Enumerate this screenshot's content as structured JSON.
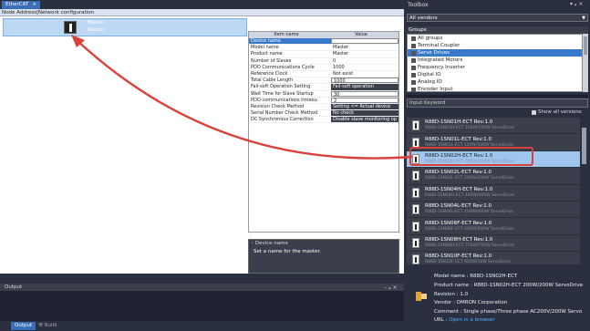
{
  "ethercat_tab": {
    "label": "EtherCAT",
    "close": "×"
  },
  "node_header": "Node Address|Network configuration",
  "master": {
    "line1": "Master",
    "line2": "Master"
  },
  "properties": {
    "col_item": "Item name",
    "col_value": "Value",
    "rows": [
      {
        "k": "Device name",
        "v": "Master",
        "style": "sel",
        "vstyle": "box"
      },
      {
        "k": "Model name",
        "v": "Master"
      },
      {
        "k": "Product name",
        "v": "Master"
      },
      {
        "k": "Number of Slaves",
        "v": "0"
      },
      {
        "k": "PDO Communications Cycle",
        "v": "1000"
      },
      {
        "k": "Reference Clock",
        "v": "Not exist"
      },
      {
        "k": "Total Cable Length",
        "v": "1000",
        "vstyle": "box"
      },
      {
        "k": "Fail-soft Operation Setting",
        "v": "Fail-soft operation",
        "vstyle": "dark"
      },
      {
        "k": "Wait Time for Slave Startup",
        "v": "30",
        "vstyle": "box"
      },
      {
        "k": "PDO communications timeou",
        "v": "2",
        "vstyle": "box"
      },
      {
        "k": "Revision Check Method",
        "v": "Setting <= Actual device",
        "vstyle": "dark"
      },
      {
        "k": "Serial Number Check Method",
        "v": "No check",
        "vstyle": "dark"
      },
      {
        "k": "DC Synchronous Correction",
        "v": "Disable slave monitoring op",
        "vstyle": "dark"
      }
    ]
  },
  "description": {
    "title": "Device name",
    "text": "Set a name for the master."
  },
  "output": {
    "title": "Output",
    "tab_output": "Output",
    "tab_build": "Build"
  },
  "toolbox": {
    "title": "Toolbox",
    "vendor": "All vendors",
    "groups_label": "Groups",
    "groups": [
      "All groups",
      "Terminal Coupler",
      "Servo Drives",
      "Integrated Motors",
      "Frequency Inverter",
      "Digital IO",
      "Analog IO",
      "Encoder Input"
    ],
    "selected_group": 2,
    "keyword_placeholder": "Input Keyword",
    "show_all_versions": "Show all versions",
    "items": [
      {
        "name": "R88D-1SN01H-ECT Rev:1.0",
        "desc": "R88D-1SN01H-ECT 100W/100W ServoDrive"
      },
      {
        "name": "R88D-1SN01L-ECT Rev:1.0",
        "desc": "R88D-1SN01L-ECT 100W/100W ServoDrive"
      },
      {
        "name": "R88D-1SN02H-ECT Rev:1.0",
        "desc": "R88D-1SN02H-ECT 200W/200W ServoDrive"
      },
      {
        "name": "R88D-1SN02L-ECT Rev:1.0",
        "desc": "R88D-1SN02L-ECT 200W/200W ServoDrive"
      },
      {
        "name": "R88D-1SN04H-ECT Rev:1.0",
        "desc": "R88D-1SN04H-ECT 400W/400W ServoDrive"
      },
      {
        "name": "R88D-1SN04L-ECT Rev:1.0",
        "desc": "R88D-1SN04L-ECT 400W/400W ServoDrive"
      },
      {
        "name": "R88D-1SN06F-ECT Rev:1.0",
        "desc": "R88D-1SN06F-ECT 600W/600W ServoDrive"
      },
      {
        "name": "R88D-1SN08H-ECT Rev:1.0",
        "desc": "R88D-1SN08H-ECT 750W/750W ServoDrive"
      },
      {
        "name": "R88D-1SN10F-ECT Rev:1.0",
        "desc": "R88D-1SN10F-ECT 900W/1kW ServoDrive"
      },
      {
        "name": "R88D-1SN10H-ECT Rev:1.0",
        "desc": "R88D-1SN10H-ECT 1kW/1kW ServoDrive"
      }
    ],
    "selected_item": 2,
    "info": {
      "model": "Model name : R88D-1SN02H-ECT",
      "product": "Product name : R88D-1SN02H-ECT 200W/200W ServoDrive",
      "revision": "Revision : 1.0",
      "vendor": "Vendor : OMRON Corporation",
      "comment": "Comment : Single phase/Three phase AC200V/200W Servo",
      "url_label": "URL :",
      "url_link": "Open in a browser"
    }
  },
  "colors": {
    "accent": "#3a78c9",
    "arrow": "#d9413a",
    "selected_item": "#9fc6ee"
  }
}
